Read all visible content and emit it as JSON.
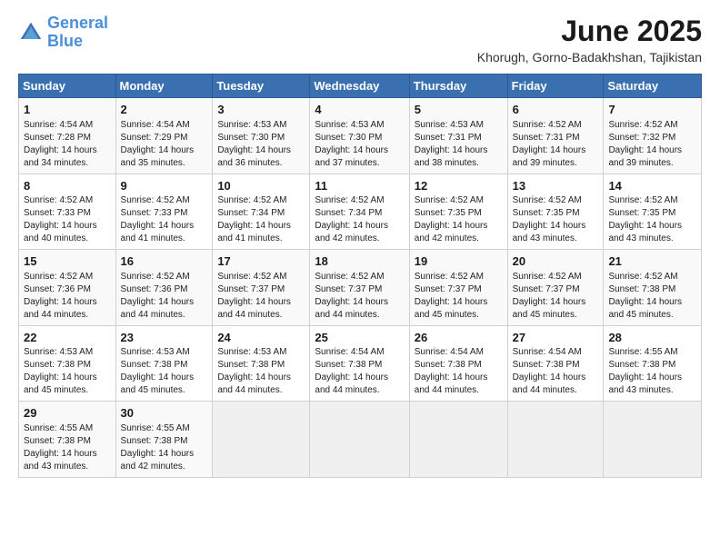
{
  "header": {
    "logo_line1": "General",
    "logo_line2": "Blue",
    "month": "June 2025",
    "location": "Khorugh, Gorno-Badakhshan, Tajikistan"
  },
  "weekdays": [
    "Sunday",
    "Monday",
    "Tuesday",
    "Wednesday",
    "Thursday",
    "Friday",
    "Saturday"
  ],
  "weeks": [
    [
      {
        "day": "1",
        "info": "Sunrise: 4:54 AM\nSunset: 7:28 PM\nDaylight: 14 hours\nand 34 minutes."
      },
      {
        "day": "2",
        "info": "Sunrise: 4:54 AM\nSunset: 7:29 PM\nDaylight: 14 hours\nand 35 minutes."
      },
      {
        "day": "3",
        "info": "Sunrise: 4:53 AM\nSunset: 7:30 PM\nDaylight: 14 hours\nand 36 minutes."
      },
      {
        "day": "4",
        "info": "Sunrise: 4:53 AM\nSunset: 7:30 PM\nDaylight: 14 hours\nand 37 minutes."
      },
      {
        "day": "5",
        "info": "Sunrise: 4:53 AM\nSunset: 7:31 PM\nDaylight: 14 hours\nand 38 minutes."
      },
      {
        "day": "6",
        "info": "Sunrise: 4:52 AM\nSunset: 7:31 PM\nDaylight: 14 hours\nand 39 minutes."
      },
      {
        "day": "7",
        "info": "Sunrise: 4:52 AM\nSunset: 7:32 PM\nDaylight: 14 hours\nand 39 minutes."
      }
    ],
    [
      {
        "day": "8",
        "info": "Sunrise: 4:52 AM\nSunset: 7:33 PM\nDaylight: 14 hours\nand 40 minutes."
      },
      {
        "day": "9",
        "info": "Sunrise: 4:52 AM\nSunset: 7:33 PM\nDaylight: 14 hours\nand 41 minutes."
      },
      {
        "day": "10",
        "info": "Sunrise: 4:52 AM\nSunset: 7:34 PM\nDaylight: 14 hours\nand 41 minutes."
      },
      {
        "day": "11",
        "info": "Sunrise: 4:52 AM\nSunset: 7:34 PM\nDaylight: 14 hours\nand 42 minutes."
      },
      {
        "day": "12",
        "info": "Sunrise: 4:52 AM\nSunset: 7:35 PM\nDaylight: 14 hours\nand 42 minutes."
      },
      {
        "day": "13",
        "info": "Sunrise: 4:52 AM\nSunset: 7:35 PM\nDaylight: 14 hours\nand 43 minutes."
      },
      {
        "day": "14",
        "info": "Sunrise: 4:52 AM\nSunset: 7:35 PM\nDaylight: 14 hours\nand 43 minutes."
      }
    ],
    [
      {
        "day": "15",
        "info": "Sunrise: 4:52 AM\nSunset: 7:36 PM\nDaylight: 14 hours\nand 44 minutes."
      },
      {
        "day": "16",
        "info": "Sunrise: 4:52 AM\nSunset: 7:36 PM\nDaylight: 14 hours\nand 44 minutes."
      },
      {
        "day": "17",
        "info": "Sunrise: 4:52 AM\nSunset: 7:37 PM\nDaylight: 14 hours\nand 44 minutes."
      },
      {
        "day": "18",
        "info": "Sunrise: 4:52 AM\nSunset: 7:37 PM\nDaylight: 14 hours\nand 44 minutes."
      },
      {
        "day": "19",
        "info": "Sunrise: 4:52 AM\nSunset: 7:37 PM\nDaylight: 14 hours\nand 45 minutes."
      },
      {
        "day": "20",
        "info": "Sunrise: 4:52 AM\nSunset: 7:37 PM\nDaylight: 14 hours\nand 45 minutes."
      },
      {
        "day": "21",
        "info": "Sunrise: 4:52 AM\nSunset: 7:38 PM\nDaylight: 14 hours\nand 45 minutes."
      }
    ],
    [
      {
        "day": "22",
        "info": "Sunrise: 4:53 AM\nSunset: 7:38 PM\nDaylight: 14 hours\nand 45 minutes."
      },
      {
        "day": "23",
        "info": "Sunrise: 4:53 AM\nSunset: 7:38 PM\nDaylight: 14 hours\nand 45 minutes."
      },
      {
        "day": "24",
        "info": "Sunrise: 4:53 AM\nSunset: 7:38 PM\nDaylight: 14 hours\nand 44 minutes."
      },
      {
        "day": "25",
        "info": "Sunrise: 4:54 AM\nSunset: 7:38 PM\nDaylight: 14 hours\nand 44 minutes."
      },
      {
        "day": "26",
        "info": "Sunrise: 4:54 AM\nSunset: 7:38 PM\nDaylight: 14 hours\nand 44 minutes."
      },
      {
        "day": "27",
        "info": "Sunrise: 4:54 AM\nSunset: 7:38 PM\nDaylight: 14 hours\nand 44 minutes."
      },
      {
        "day": "28",
        "info": "Sunrise: 4:55 AM\nSunset: 7:38 PM\nDaylight: 14 hours\nand 43 minutes."
      }
    ],
    [
      {
        "day": "29",
        "info": "Sunrise: 4:55 AM\nSunset: 7:38 PM\nDaylight: 14 hours\nand 43 minutes."
      },
      {
        "day": "30",
        "info": "Sunrise: 4:55 AM\nSunset: 7:38 PM\nDaylight: 14 hours\nand 42 minutes."
      },
      {
        "day": "",
        "info": ""
      },
      {
        "day": "",
        "info": ""
      },
      {
        "day": "",
        "info": ""
      },
      {
        "day": "",
        "info": ""
      },
      {
        "day": "",
        "info": ""
      }
    ]
  ]
}
